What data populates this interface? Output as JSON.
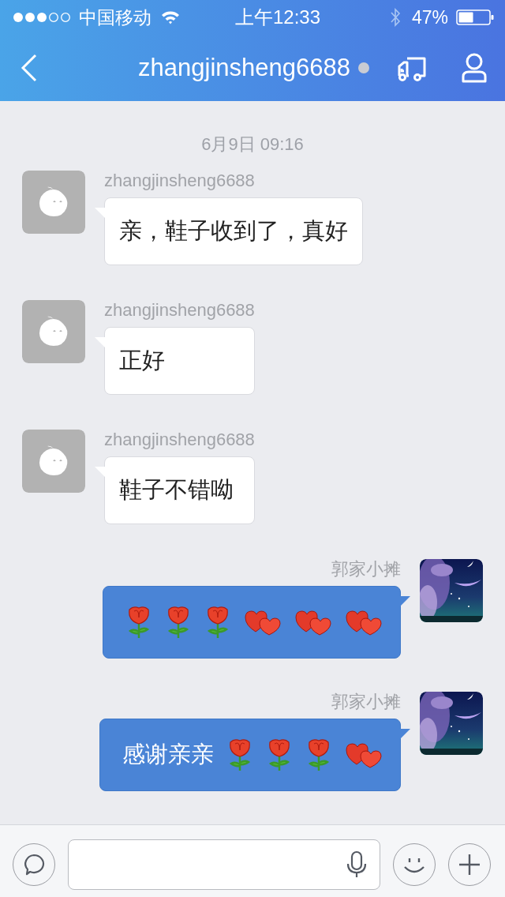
{
  "status_bar": {
    "carrier": "中国移动",
    "time": "上午12:33",
    "battery": "47%"
  },
  "header": {
    "title": "zhangjinsheng6688",
    "online": false
  },
  "timestamp": "6月9日 09:16",
  "messages": [
    {
      "kind": "incoming",
      "sender": "zhangjinsheng6688",
      "parts": [
        {
          "kind": "text",
          "text": "亲，鞋子收到了，真好"
        }
      ]
    },
    {
      "kind": "incoming",
      "sender": "zhangjinsheng6688",
      "parts": [
        {
          "kind": "text",
          "text": "正好"
        }
      ]
    },
    {
      "kind": "incoming",
      "sender": "zhangjinsheng6688",
      "parts": [
        {
          "kind": "text",
          "text": "鞋子不错呦"
        }
      ]
    },
    {
      "kind": "outgoing",
      "sender": "郭家小摊",
      "parts": [
        {
          "kind": "rose"
        },
        {
          "kind": "rose"
        },
        {
          "kind": "rose"
        },
        {
          "kind": "hearts"
        },
        {
          "kind": "hearts"
        },
        {
          "kind": "hearts"
        }
      ]
    },
    {
      "kind": "outgoing",
      "sender": "郭家小摊",
      "parts": [
        {
          "kind": "text",
          "text": "感谢亲亲"
        },
        {
          "kind": "rose"
        },
        {
          "kind": "rose"
        },
        {
          "kind": "rose"
        },
        {
          "kind": "hearts"
        }
      ]
    }
  ]
}
